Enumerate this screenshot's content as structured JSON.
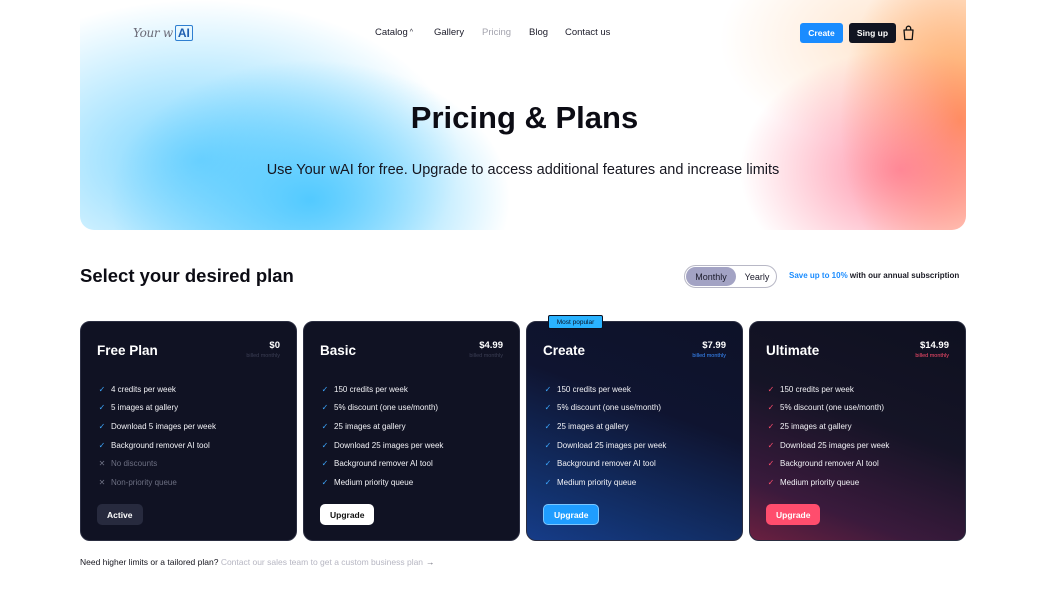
{
  "header": {
    "logo_text": "Your wAI",
    "menu": [
      {
        "label": "Catalog",
        "caret": "^"
      },
      {
        "label": "Gallery"
      },
      {
        "label": "Pricing"
      },
      {
        "label": "Blog"
      },
      {
        "label": "Contact us"
      }
    ],
    "create_label": "Create",
    "signup_label": "Sing up"
  },
  "hero": {
    "title": "Pricing & Plans",
    "subtitle": "Use Your wAI for free. Upgrade to access additional features and increase limits"
  },
  "plans_section": {
    "title": "Select your desired plan",
    "toggle": {
      "monthly": "Monthly",
      "yearly": "Yearly",
      "selected": "Monthly"
    },
    "save_highlight": "Save up to 10%",
    "save_rest": " with our annual subscription",
    "badge": "Most popular"
  },
  "plans": [
    {
      "name": "Free Plan",
      "price": "$0",
      "billed": "billed monthly",
      "button": "Active",
      "features": [
        {
          "text": "4 credits per week",
          "mark": "✓"
        },
        {
          "text": "5 images at gallery",
          "mark": "✓"
        },
        {
          "text": "Download 5 images per week",
          "mark": "✓"
        },
        {
          "text": "Background remover AI tool",
          "mark": "✓"
        },
        {
          "text": "No discounts",
          "mark": "✕"
        },
        {
          "text": "Non-priority queue",
          "mark": "✕"
        }
      ]
    },
    {
      "name": "Basic",
      "price": "$4.99",
      "billed": "billed monthly",
      "button": "Upgrade",
      "features": [
        {
          "text": "150 credits per week",
          "mark": "✓"
        },
        {
          "text": "5% discount (one use/month)",
          "mark": "✓"
        },
        {
          "text": "25 images at gallery",
          "mark": "✓"
        },
        {
          "text": "Download 25 images per week",
          "mark": "✓"
        },
        {
          "text": "Background remover AI tool",
          "mark": "✓"
        },
        {
          "text": "Medium priority queue",
          "mark": "✓"
        }
      ]
    },
    {
      "name": "Create",
      "price": "$7.99",
      "billed": "billed monthly",
      "button": "Upgrade",
      "features": [
        {
          "text": "150 credits per week",
          "mark": "✓"
        },
        {
          "text": "5% discount (one use/month)",
          "mark": "✓"
        },
        {
          "text": "25 images at gallery",
          "mark": "✓"
        },
        {
          "text": "Download 25 images per week",
          "mark": "✓"
        },
        {
          "text": "Background remover AI tool",
          "mark": "✓"
        },
        {
          "text": "Medium priority queue",
          "mark": "✓"
        }
      ]
    },
    {
      "name": "Ultimate",
      "price": "$14.99",
      "billed": "billed monthly",
      "button": "Upgrade",
      "features": [
        {
          "text": "150 credits per week",
          "mark": "✓"
        },
        {
          "text": "5% discount (one use/month)",
          "mark": "✓"
        },
        {
          "text": "25 images at gallery",
          "mark": "✓"
        },
        {
          "text": "Download 25 images per week",
          "mark": "✓"
        },
        {
          "text": "Background remover AI tool",
          "mark": "✓"
        },
        {
          "text": "Medium priority queue",
          "mark": "✓"
        }
      ]
    }
  ],
  "footer": {
    "question": "Need higher limits or a tailored plan?",
    "link": "Contact our sales team to get a custom business plan",
    "arrow": "→"
  },
  "colors": {
    "accent_blue": "#1a8cff",
    "accent_pink": "#ff4d6d",
    "card_dark": "#101223"
  }
}
